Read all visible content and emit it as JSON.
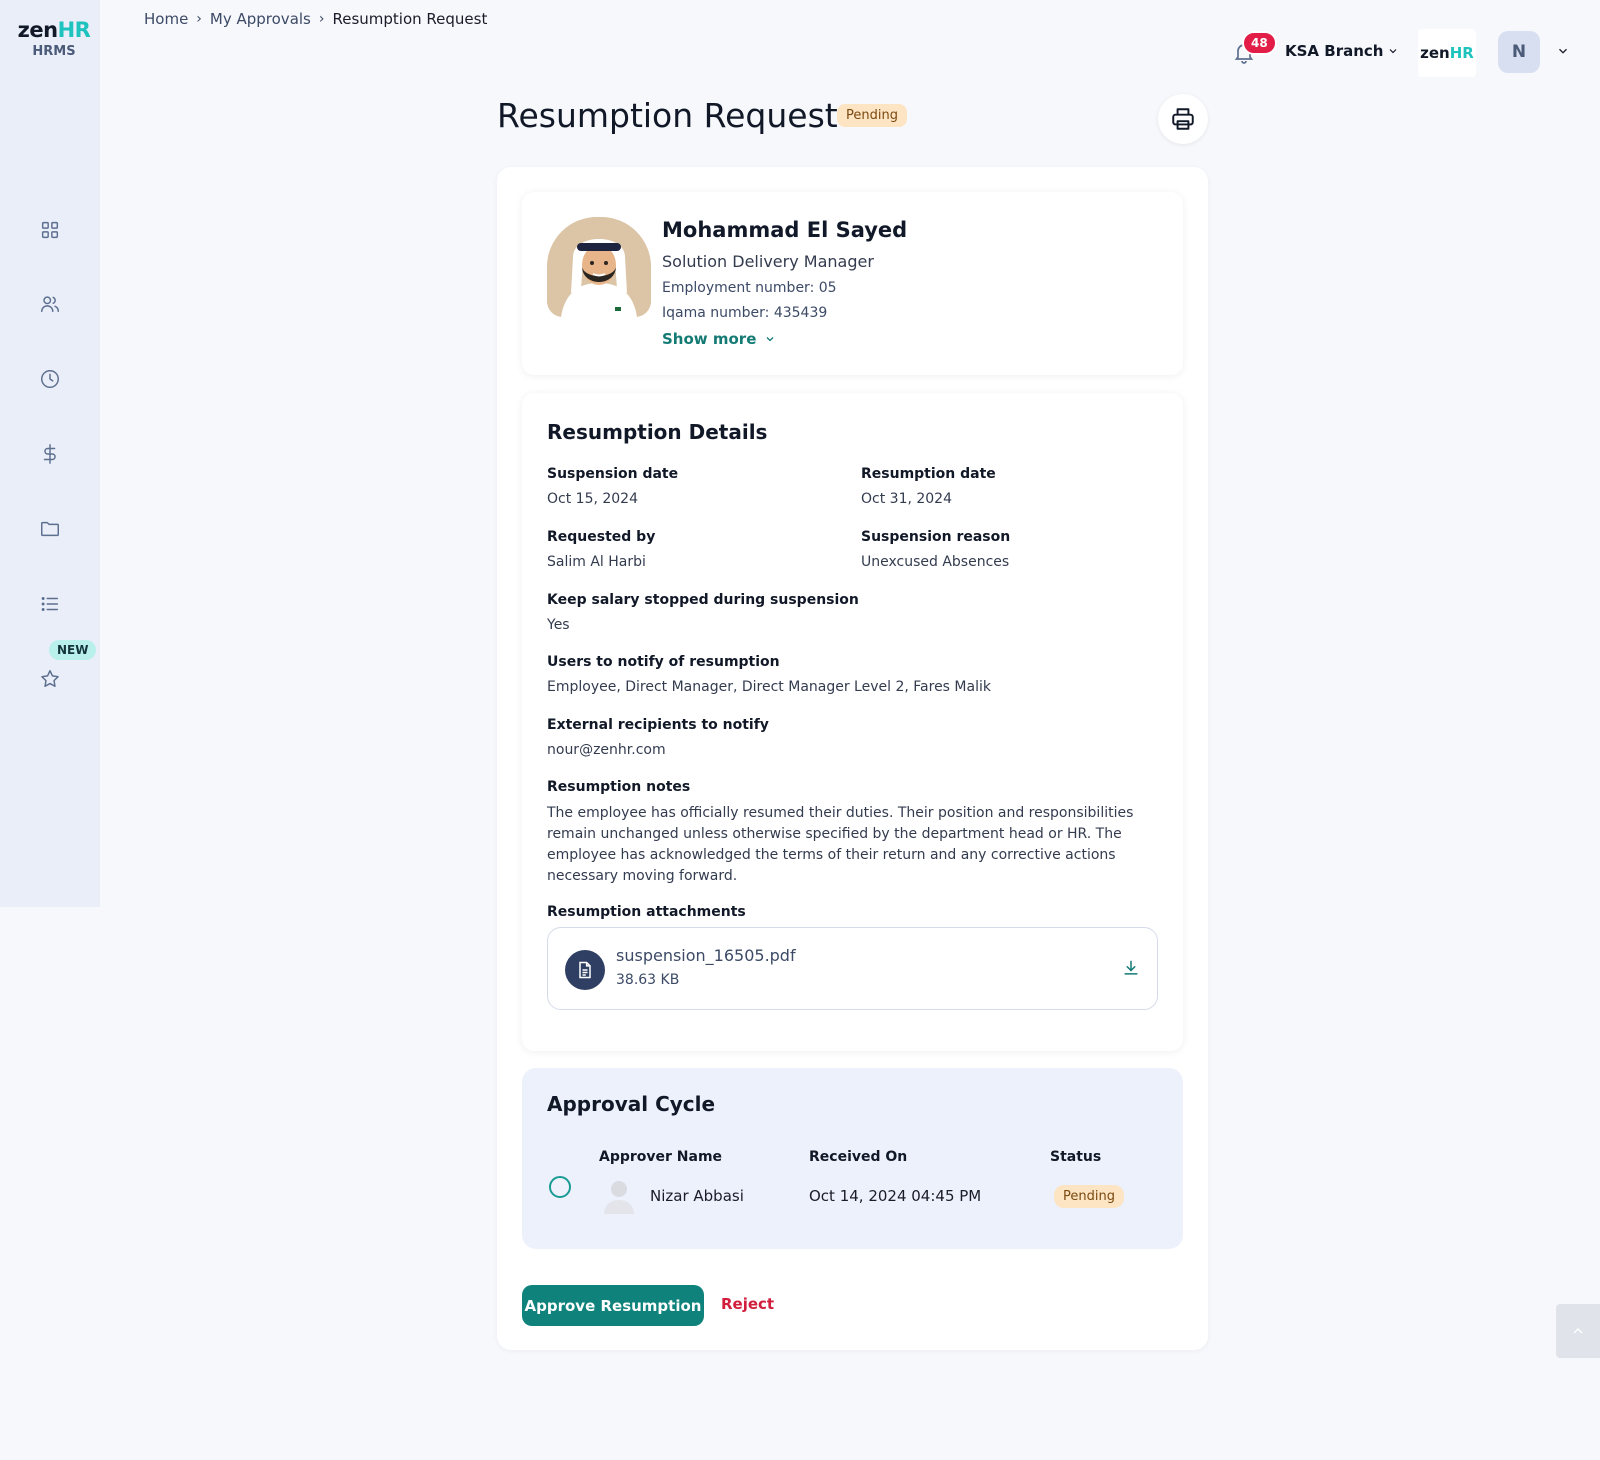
{
  "app": {
    "logo_main": "zen",
    "logo_accent": "HR",
    "logo_sub": "HRMS",
    "nav_new_badge": "NEW"
  },
  "breadcrumb": {
    "home": "Home",
    "approvals": "My Approvals",
    "current": "Resumption Request"
  },
  "topbar": {
    "notification_count": "48",
    "branch": "KSA Branch",
    "company_logo_main": "zen",
    "company_logo_accent": "HR",
    "user_initial": "N"
  },
  "page": {
    "title": "Resumption Request",
    "status": "Pending"
  },
  "employee": {
    "name": "Mohammad El Sayed",
    "role": "Solution Delivery Manager",
    "employment_number": "Employment number: 05",
    "iqama_number": "Iqama number: 435439",
    "show_more": "Show more"
  },
  "details": {
    "title": "Resumption Details",
    "suspension_date_label": "Suspension date",
    "suspension_date": "Oct 15, 2024",
    "resumption_date_label": "Resumption date",
    "resumption_date": "Oct 31, 2024",
    "requested_by_label": "Requested by",
    "requested_by": "Salim Al Harbi",
    "suspension_reason_label": "Suspension reason",
    "suspension_reason": "Unexcused Absences",
    "keep_salary_label": "Keep salary stopped during suspension",
    "keep_salary": "Yes",
    "users_notify_label": "Users to notify of resumption",
    "users_notify": "Employee, Direct Manager, Direct Manager Level 2, Fares Malik",
    "external_label": "External recipients to notify",
    "external": "nour@zenhr.com",
    "notes_label": "Resumption notes",
    "notes": "The employee has officially resumed their duties. Their position and responsibilities remain unchanged unless otherwise specified by the department head or HR. The employee has acknowledged the terms of their return and any corrective actions necessary moving forward.",
    "attachments_label": "Resumption attachments",
    "attachment_name": "suspension_16505.pdf",
    "attachment_size": "38.63 KB"
  },
  "approval": {
    "title": "Approval Cycle",
    "col_approver": "Approver Name",
    "col_received": "Received On",
    "col_status": "Status",
    "rows": [
      {
        "name": "Nizar Abbasi",
        "received": "Oct 14, 2024 04:45 PM",
        "status": "Pending"
      }
    ]
  },
  "actions": {
    "approve": "Approve Resumption",
    "reject": "Reject"
  },
  "colors": {
    "primary": "#0f837b",
    "accent": "#1ec3bd",
    "danger": "#d11e3c",
    "pending_bg": "#fde4c3",
    "sidebar_bg": "#e9eef9"
  },
  "icons": {
    "nav": [
      "dashboard-icon",
      "people-icon",
      "clock-icon",
      "dollar-icon",
      "folder-icon",
      "list-icon",
      "star-icon"
    ]
  }
}
